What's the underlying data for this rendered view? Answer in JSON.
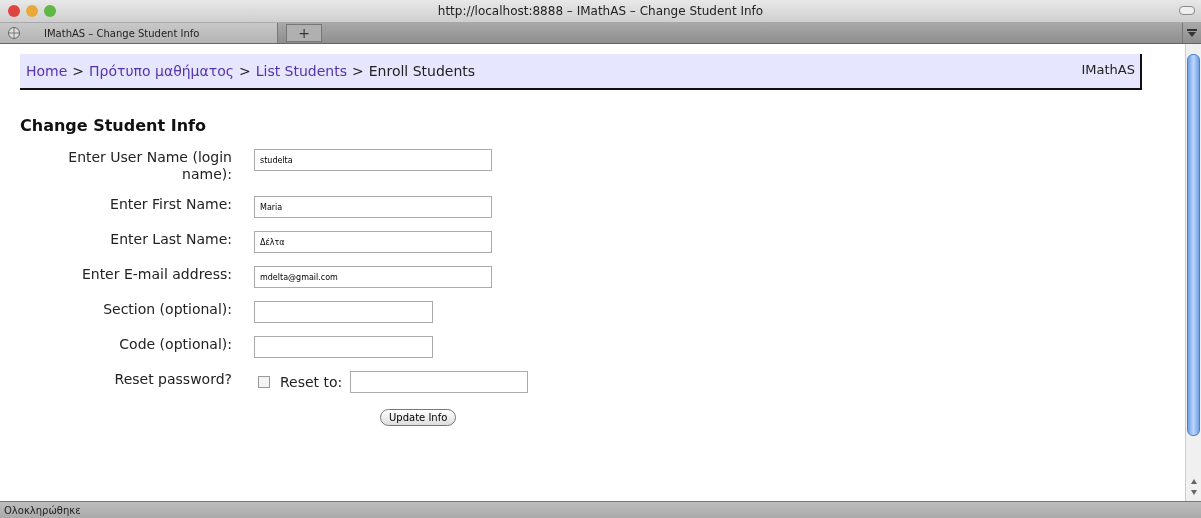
{
  "window": {
    "title": "http://localhost:8888 – IMathAS – Change Student Info"
  },
  "tabs": [
    {
      "label": "IMathAS – Change Student Info",
      "selected": true
    }
  ],
  "new_tab": "+",
  "breadcrumb": {
    "items": [
      {
        "label": "Home",
        "kind": "link"
      },
      {
        "label": "Πρότυπο μαθήματος",
        "kind": "link"
      },
      {
        "label": "List Students",
        "kind": "link"
      },
      {
        "label": "Enroll Students",
        "kind": "text"
      }
    ],
    "separator": ">"
  },
  "brand": "IMathAS",
  "heading": "Change Student Info",
  "fields": [
    {
      "label": "Enter User Name (login name):",
      "value": "studelta",
      "kind": "long"
    },
    {
      "label": "Enter First Name:",
      "value": "Maria",
      "kind": "long"
    },
    {
      "label": "Enter Last Name:",
      "value": "Δέλτα",
      "kind": "long"
    },
    {
      "label": "Enter E-mail address:",
      "value": "mdelta@gmail.com",
      "kind": "long"
    },
    {
      "label": "Section (optional):",
      "kind": "short"
    },
    {
      "label": "Code (optional):",
      "kind": "short"
    }
  ],
  "reset": {
    "label": "Reset password?",
    "checked": false,
    "reset_to_label": "Reset to:"
  },
  "submit": "Update Info",
  "status_bar": "Ολοκληρώθηκε"
}
